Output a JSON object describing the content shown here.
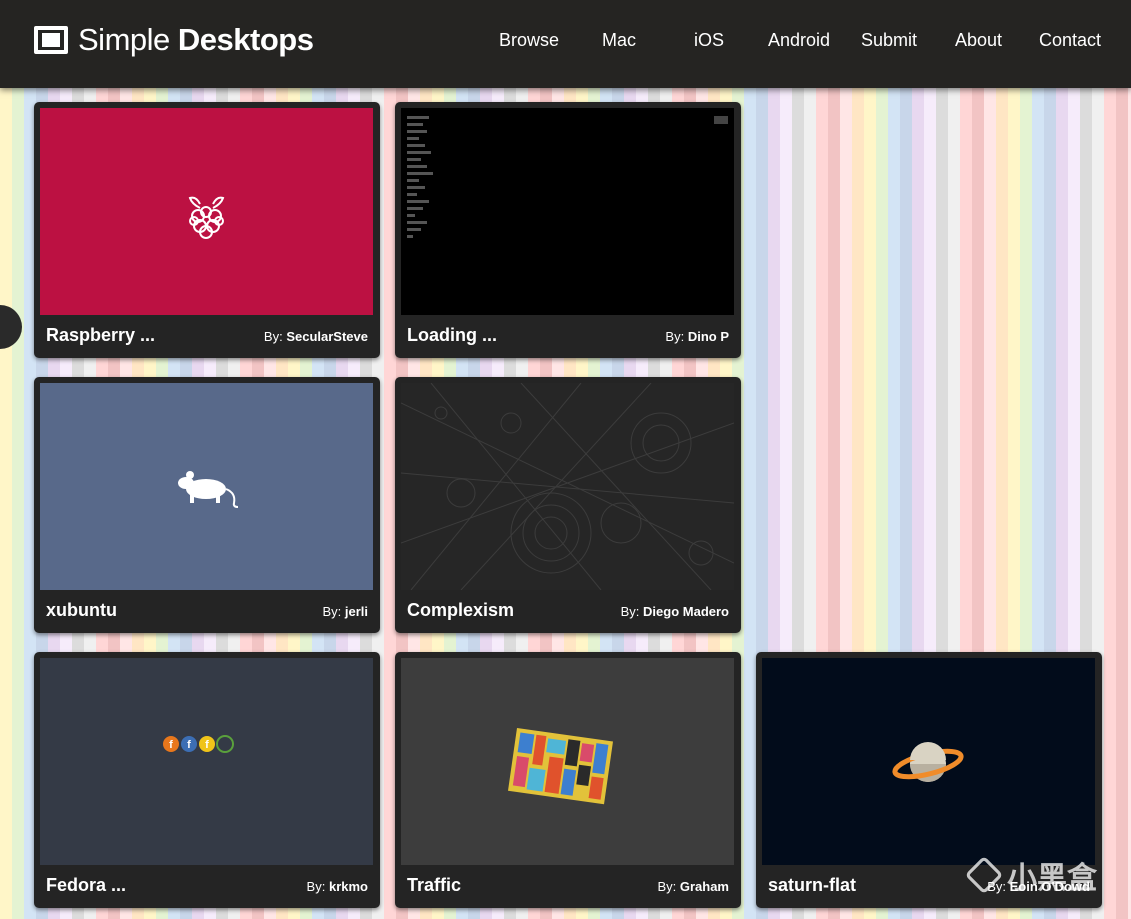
{
  "site": {
    "logo_light": "Simple",
    "logo_bold": "Desktops"
  },
  "nav": [
    {
      "label": "Browse"
    },
    {
      "label": "Mac"
    },
    {
      "label": "iOS"
    },
    {
      "label": "Android"
    },
    {
      "label": "Submit"
    },
    {
      "label": "About"
    },
    {
      "label": "Contact"
    }
  ],
  "cards": [
    {
      "title": "Raspberry ...",
      "by": "By:",
      "author": "SecularSteve",
      "bg": "#bc1142",
      "icon": "raspberry-icon"
    },
    {
      "title": "Loading ...",
      "by": "By:",
      "author": "Dino P",
      "bg": "#000000",
      "icon": "terminal-text-art"
    },
    {
      "title": "xubuntu",
      "by": "By:",
      "author": "jerli",
      "bg": "#58698a",
      "icon": "mouse-icon"
    },
    {
      "title": "Complexism",
      "by": "By:",
      "author": "Diego Madero",
      "bg": "#262626",
      "icon": "particle-tracks-art"
    },
    {
      "title": "Fedora ...",
      "by": "By:",
      "author": "krkmo",
      "bg": "#343a46",
      "icon": "fedora-logos-icon"
    },
    {
      "title": "Traffic",
      "by": "By:",
      "author": "Graham",
      "bg": "#3d3d3d",
      "icon": "traffic-blocks-art"
    },
    {
      "title": "saturn-flat",
      "by": "By:",
      "author": "Eoin O'Dowd",
      "bg": "#020c1b",
      "icon": "saturn-icon"
    }
  ],
  "watermark": {
    "text": "小黑盒"
  },
  "colors": {
    "header": "#252422",
    "card": "#242424"
  }
}
